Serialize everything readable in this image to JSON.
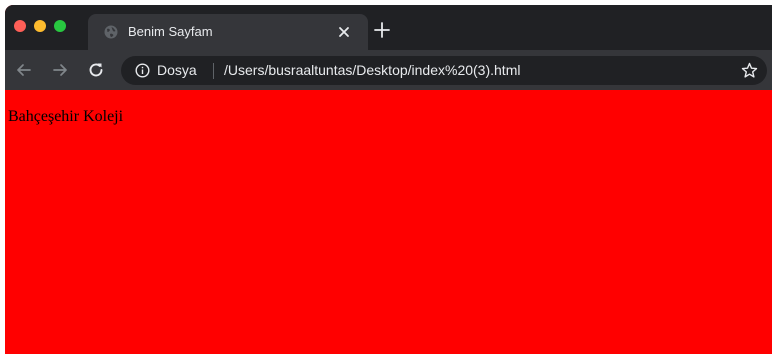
{
  "colors": {
    "tab_strip": "#202124",
    "active_tab": "#35363a",
    "omnibox": "#202124",
    "page_background": "#ff0000",
    "text_light": "#e8eaed"
  },
  "window_controls": {
    "close": "close-window",
    "minimize": "minimize-window",
    "zoom": "zoom-window"
  },
  "tab": {
    "title": "Benim Sayfam",
    "favicon": "globe-icon",
    "close_label": "×"
  },
  "new_tab_label": "+",
  "toolbar": {
    "back": "arrow-left-icon",
    "forward": "arrow-right-icon",
    "reload": "reload-icon"
  },
  "omnibox": {
    "scheme_label": "Dosya",
    "url": "/Users/busraaltuntas/Desktop/index%20(3).html",
    "bookmark": "star-icon"
  },
  "page": {
    "text": "Bahçeşehir Koleji"
  }
}
